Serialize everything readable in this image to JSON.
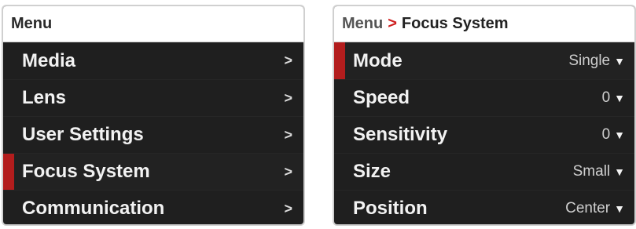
{
  "left_panel": {
    "header": "Menu",
    "items": [
      {
        "label": "Media",
        "arrow": ">"
      },
      {
        "label": "Lens",
        "arrow": ">"
      },
      {
        "label": "User Settings",
        "arrow": ">"
      },
      {
        "label": "Focus System",
        "arrow": ">"
      },
      {
        "label": "Communication",
        "arrow": ">"
      }
    ],
    "selected_index": 3
  },
  "right_panel": {
    "breadcrumb": {
      "root": "Menu",
      "separator": ">",
      "current": "Focus System"
    },
    "items": [
      {
        "label": "Mode",
        "value": "Single"
      },
      {
        "label": "Speed",
        "value": "0"
      },
      {
        "label": "Sensitivity",
        "value": "0"
      },
      {
        "label": "Size",
        "value": "Small"
      },
      {
        "label": "Position",
        "value": "Center"
      }
    ],
    "dropdown_glyph": "▼",
    "selected_index": 0
  },
  "colors": {
    "panel_background": "#1f1f1f",
    "header_background": "#ffffff",
    "selection_accent": "#b31d1d",
    "breadcrumb_separator": "#cf2020"
  }
}
